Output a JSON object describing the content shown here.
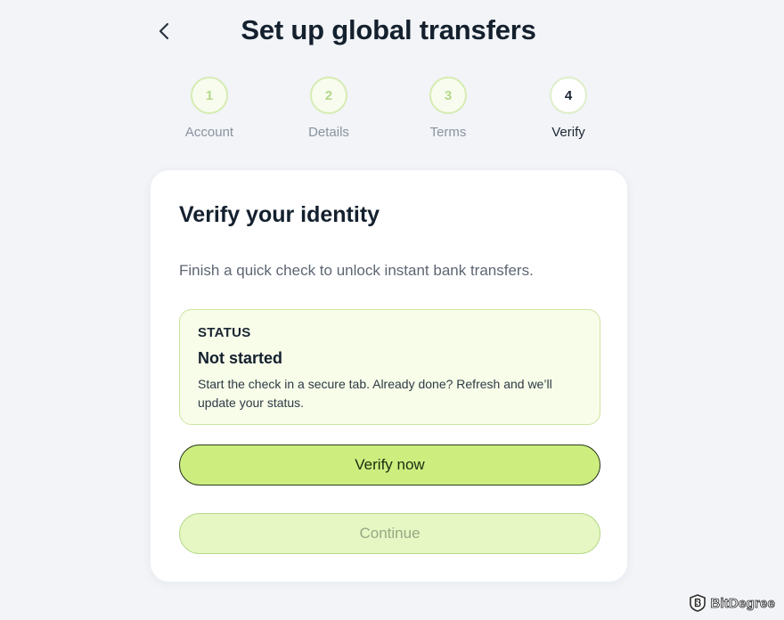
{
  "header": {
    "title": "Set up global transfers"
  },
  "stepper": {
    "steps": [
      {
        "number": "1",
        "label": "Account"
      },
      {
        "number": "2",
        "label": "Details"
      },
      {
        "number": "3",
        "label": "Terms"
      },
      {
        "number": "4",
        "label": "Verify"
      }
    ],
    "active_step": 4
  },
  "card": {
    "title": "Verify your identity",
    "subtitle": "Finish a quick check to unlock instant bank transfers.",
    "status": {
      "label": "STATUS",
      "value": "Not started",
      "description": "Start the check in a secure tab. Already done? Refresh and we’ll update your status."
    },
    "primary_button": "Verify now",
    "secondary_button": "Continue"
  },
  "watermark": {
    "text": "BitDegree"
  },
  "colors": {
    "background": "#f2f4f8",
    "accent_lime": "#cdee7f",
    "accent_lime_light": "#e6f7c4",
    "status_box_bg": "#f7fde9",
    "text_dark": "#14202e"
  },
  "icons": {
    "back": "chevron-left-icon",
    "watermark": "bitdegree-logo-icon"
  }
}
